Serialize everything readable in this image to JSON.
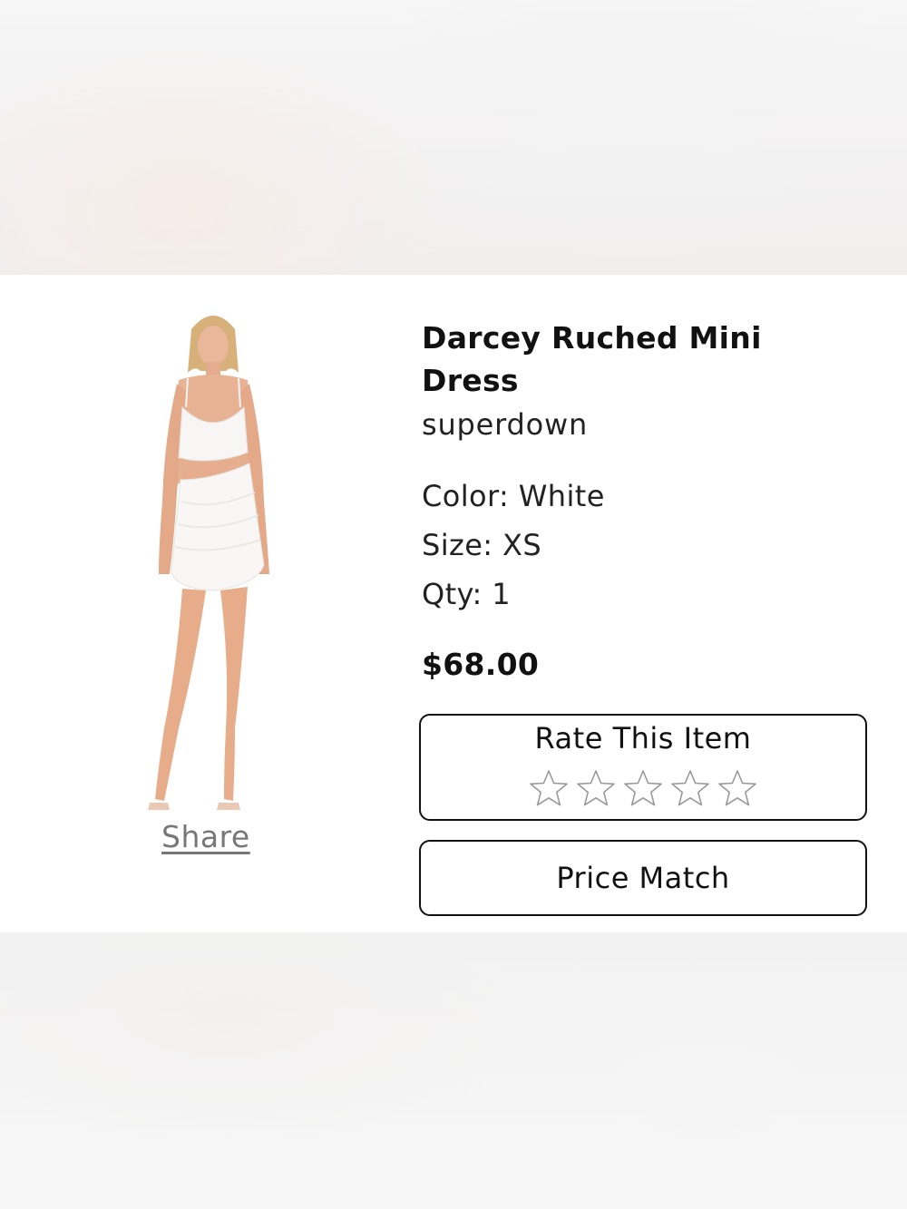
{
  "product": {
    "title": "Darcey Ruched Mini Dress",
    "brand": "superdown",
    "color_label": "Color: White",
    "size_label": "Size: XS",
    "qty_label": "Qty: 1",
    "price": "$68.00"
  },
  "actions": {
    "share_label": "Share",
    "rate_label": "Rate This Item",
    "rating": 0,
    "rating_max": 5,
    "price_match_label": "Price Match"
  },
  "colors": {
    "text": "#111111",
    "share_link": "#777777",
    "star_outline": "#999999",
    "card_background": "#ffffff"
  }
}
